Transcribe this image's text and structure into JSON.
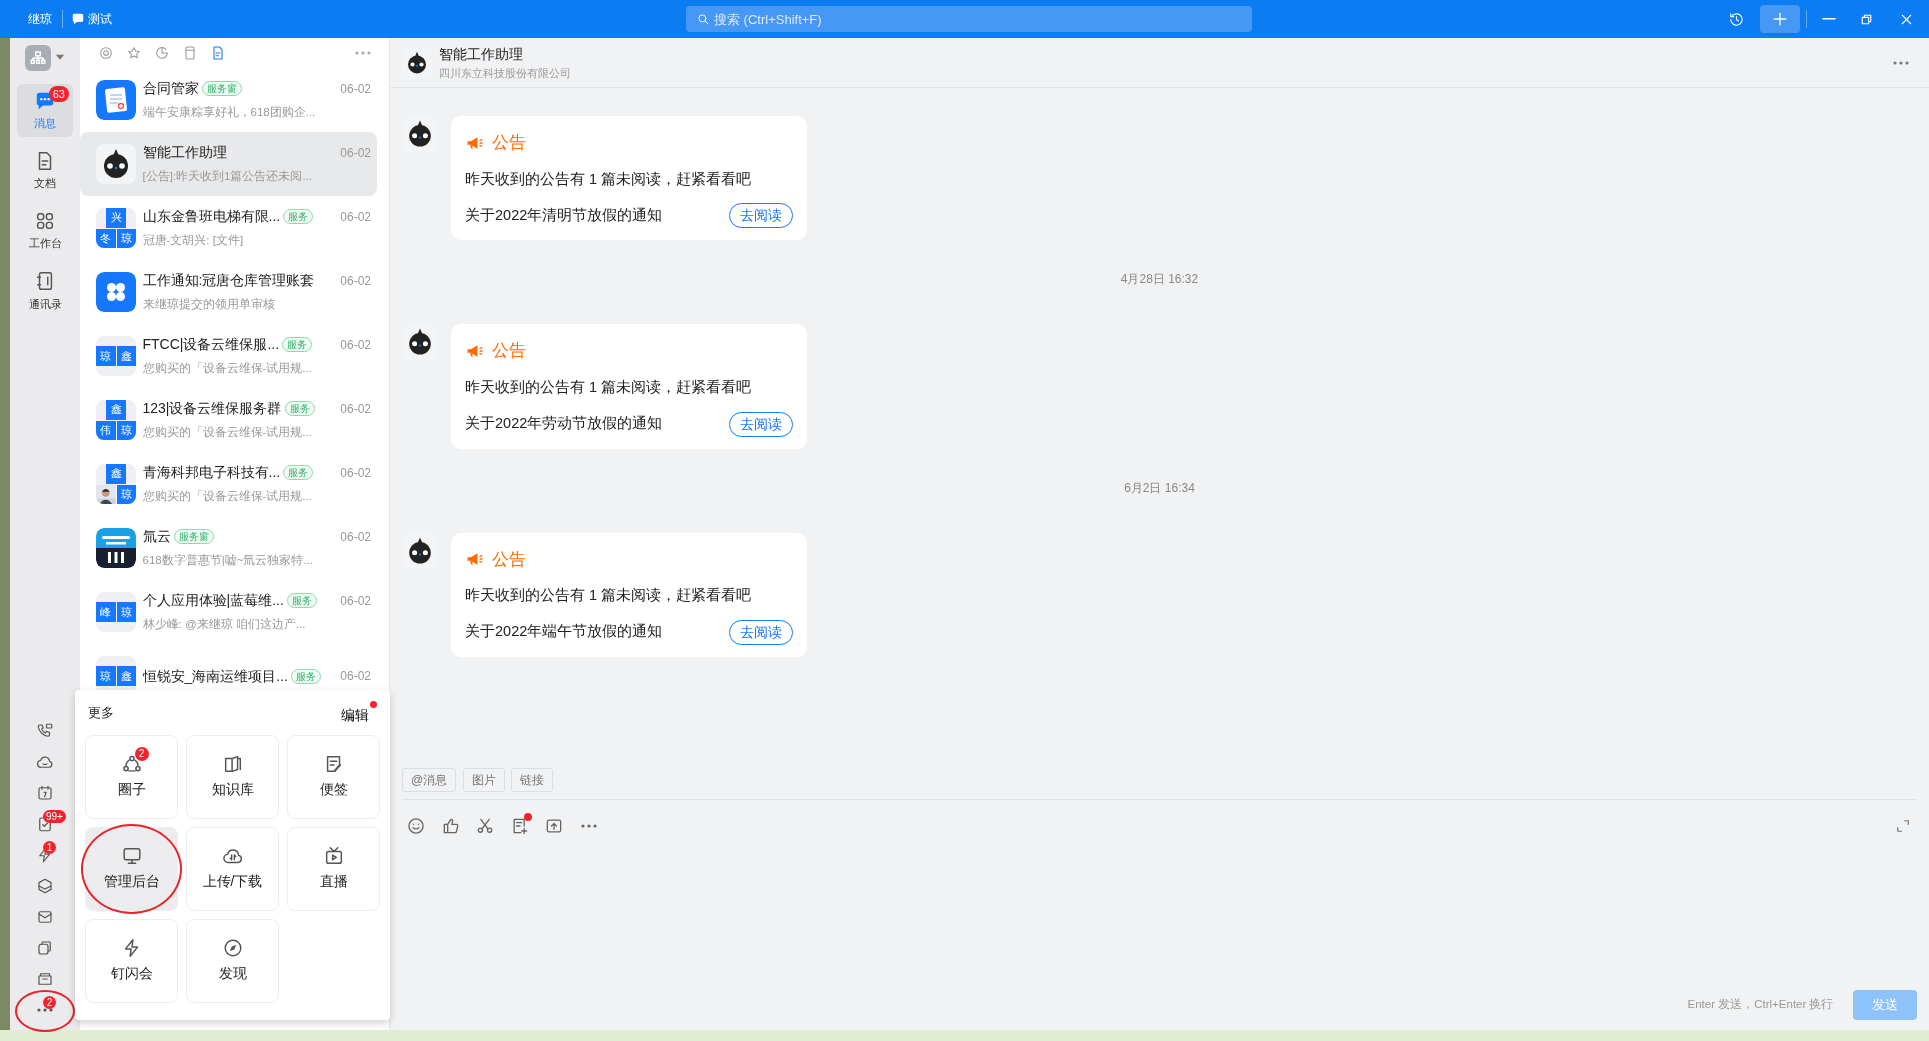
{
  "titlebar": {
    "user": "继琼",
    "chat_label": "测试",
    "search": {
      "placeholder": "搜索 (Ctrl+Shift+F)"
    },
    "controls": [
      {
        "kind": "history"
      },
      {
        "kind": "plus"
      },
      {
        "kind": "minimize"
      },
      {
        "kind": "restore"
      },
      {
        "kind": "close"
      }
    ]
  },
  "rail": {
    "items": [
      {
        "label": "消息",
        "kind": "chat",
        "selected": true,
        "badge": "63"
      },
      {
        "label": "文档",
        "kind": "doc",
        "selected": false
      },
      {
        "label": "工作台",
        "kind": "grid",
        "selected": false
      },
      {
        "label": "通讯录",
        "kind": "contacts",
        "selected": false
      }
    ],
    "tools": [
      {
        "kind": "phone"
      },
      {
        "kind": "cloud"
      },
      {
        "kind": "calendar"
      },
      {
        "kind": "todo",
        "badge": "99+"
      },
      {
        "kind": "bolt",
        "badge": "1"
      },
      {
        "kind": "cube"
      },
      {
        "kind": "mail"
      },
      {
        "kind": "copy"
      },
      {
        "kind": "folder"
      },
      {
        "kind": "dots",
        "badge": "2",
        "circled": true
      }
    ]
  },
  "conversation_filters": [
    {
      "kind": "at",
      "selected": false
    },
    {
      "kind": "star",
      "selected": false
    },
    {
      "kind": "clock",
      "selected": false
    },
    {
      "kind": "device",
      "selected": false
    },
    {
      "kind": "doc",
      "selected": true
    }
  ],
  "conversations": [
    {
      "avatar": {
        "kind": "contract"
      },
      "name": "合同管家",
      "tag": "服务窗",
      "date": "06-02",
      "preview": "端午安康粽享好礼，618团购企...",
      "selected": false
    },
    {
      "avatar": {
        "kind": "bot"
      },
      "name": "智能工作助理",
      "date": "06-02",
      "preview": "[公告]:昨天收到1篇公告还未阅...",
      "selected": true
    },
    {
      "avatar": {
        "kind": "group",
        "tiles": [
          {
            "kind": "text",
            "text": "兴"
          },
          {
            "kind": "text",
            "text": "冬"
          },
          {
            "kind": "text",
            "text": "琼"
          }
        ]
      },
      "name": "山东金鲁班电梯有限...",
      "tag": "服务",
      "date": "06-02",
      "preview": "冠唐-文胡兴: [文件]",
      "selected": false
    },
    {
      "avatar": {
        "kind": "work"
      },
      "name": "工作通知:冠唐仓库管理账套",
      "date": "06-02",
      "preview": "来继琼提交的领用单审核",
      "selected": false
    },
    {
      "avatar": {
        "kind": "group",
        "tiles": [
          {
            "kind": "text",
            "text": "琼"
          },
          {
            "kind": "text",
            "text": "鑫"
          }
        ]
      },
      "name": "FTCC|设备云维保服...",
      "tag": "服务",
      "date": "06-02",
      "preview": "您购买的「设备云维保-试用规...",
      "selected": false
    },
    {
      "avatar": {
        "kind": "group",
        "tiles": [
          {
            "kind": "text",
            "text": "鑫"
          },
          {
            "kind": "text",
            "text": "伟"
          },
          {
            "kind": "text",
            "text": "琼"
          }
        ]
      },
      "name": "123|设备云维保服务群",
      "tag": "服务",
      "date": "06-02",
      "preview": "您购买的「设备云维保-试用规...",
      "selected": false
    },
    {
      "avatar": {
        "kind": "group",
        "tiles": [
          {
            "kind": "text",
            "text": "鑫"
          },
          {
            "kind": "picture"
          },
          {
            "kind": "text",
            "text": "琼"
          }
        ]
      },
      "name": "青海科邦电子科技有...",
      "tag": "服务",
      "date": "06-02",
      "preview": "您购买的「设备云维保-试用规...",
      "selected": false
    },
    {
      "avatar": {
        "kind": "cloud"
      },
      "name": "氚云",
      "tag": "服务窗",
      "date": "06-02",
      "preview": "618数字普惠节|嘘~氚云独家特...",
      "selected": false
    },
    {
      "avatar": {
        "kind": "group",
        "tiles": [
          {
            "kind": "text",
            "text": "峰"
          },
          {
            "kind": "text",
            "text": "琼"
          }
        ]
      },
      "name": "个人应用体验|蓝莓维...",
      "tag": "服务",
      "date": "06-02",
      "preview": "林少峰: @来继琼  咱们这边产...",
      "selected": false
    },
    {
      "avatar": {
        "kind": "group",
        "tiles": [
          {
            "kind": "text",
            "text": "琼"
          },
          {
            "kind": "text",
            "text": "鑫"
          }
        ]
      },
      "name": "恒锐安_海南运维项目...",
      "tag": "服务",
      "date": "06-02",
      "selected": false
    }
  ],
  "more_panel": {
    "title": "更多",
    "edit": "编辑",
    "edit_dot": true,
    "tiles": [
      {
        "label": "圈子",
        "kind": "circle",
        "badge": "2",
        "selected": false
      },
      {
        "label": "知识库",
        "kind": "book",
        "selected": false
      },
      {
        "label": "便签",
        "kind": "note",
        "selected": false
      },
      {
        "label": "管理后台",
        "kind": "monitor",
        "selected": true,
        "circled": true
      },
      {
        "label": "上传/下载",
        "kind": "transfer",
        "selected": false
      },
      {
        "label": "直播",
        "kind": "tv",
        "selected": false
      },
      {
        "label": "钉闪会",
        "kind": "bolt",
        "selected": false
      },
      {
        "label": "发现",
        "kind": "compass",
        "selected": false
      }
    ]
  },
  "chat": {
    "title": "智能工作助理",
    "subtitle": "四川东立科技股份有限公司",
    "messages": [
      {
        "kind": "announcement",
        "title": "公告",
        "body": "昨天收到的公告有 1 篇未阅读，赶紧看看吧",
        "notice": "关于2022年清明节放假的通知",
        "button": "去阅读"
      },
      {
        "kind": "time",
        "text": "4月28日 16:32"
      },
      {
        "kind": "announcement",
        "title": "公告",
        "body": "昨天收到的公告有 1 篇未阅读，赶紧看看吧",
        "notice": "关于2022年劳动节放假的通知",
        "button": "去阅读"
      },
      {
        "kind": "time",
        "text": "6月2日 16:34"
      },
      {
        "kind": "announcement",
        "title": "公告",
        "body": "昨天收到的公告有 1 篇未阅读，赶紧看看吧",
        "notice": "关于2022年端午节放假的通知",
        "button": "去阅读"
      }
    ],
    "quick_chips": [
      "@消息",
      "图片",
      "链接"
    ],
    "toolbar": [
      {
        "kind": "emoji"
      },
      {
        "kind": "thumb"
      },
      {
        "kind": "scissors"
      },
      {
        "kind": "docplus",
        "dot": true
      },
      {
        "kind": "upload"
      },
      {
        "kind": "dots"
      }
    ],
    "hint": "Enter 发送，Ctrl+Enter 换行",
    "send": {
      "label": "发送",
      "disabled": true
    }
  }
}
